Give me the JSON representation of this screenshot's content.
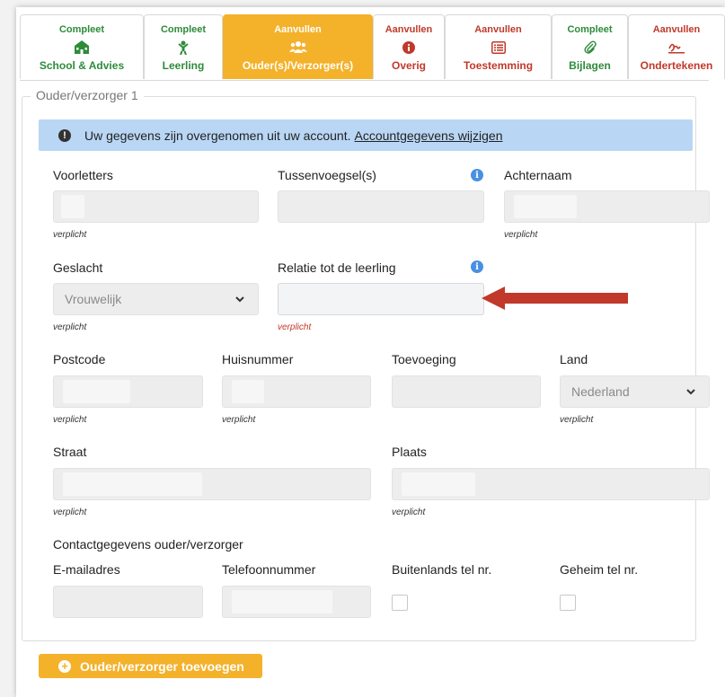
{
  "tabs": [
    {
      "status": "Compleet",
      "label": "School & Advies",
      "icon": "school-icon",
      "state": "done"
    },
    {
      "status": "Compleet",
      "label": "Leerling",
      "icon": "student-icon",
      "state": "done"
    },
    {
      "status": "Aanvullen",
      "label": "Ouder(s)/Verzorger(s)",
      "icon": "users-icon",
      "state": "active"
    },
    {
      "status": "Aanvullen",
      "label": "Overig",
      "icon": "info-icon",
      "state": "todo"
    },
    {
      "status": "Aanvullen",
      "label": "Toestemming",
      "icon": "list-icon",
      "state": "todo"
    },
    {
      "status": "Compleet",
      "label": "Bijlagen",
      "icon": "paperclip-icon",
      "state": "done"
    },
    {
      "status": "Aanvullen",
      "label": "Ondertekenen",
      "icon": "signature-icon",
      "state": "todo"
    }
  ],
  "section_legend": "Ouder/verzorger 1",
  "info_banner": {
    "text": "Uw gegevens zijn overgenomen uit uw account.",
    "link": "Accountgegevens wijzigen"
  },
  "fields": {
    "voorletters": {
      "label": "Voorletters",
      "note": "verplicht"
    },
    "tussenvoegsel": {
      "label": "Tussenvoegsel(s)"
    },
    "achternaam": {
      "label": "Achternaam",
      "note": "verplicht"
    },
    "geslacht": {
      "label": "Geslacht",
      "value": "Vrouwelijk",
      "note": "verplicht"
    },
    "relatie": {
      "label": "Relatie tot de leerling",
      "note": "verplicht"
    },
    "postcode": {
      "label": "Postcode",
      "note": "verplicht"
    },
    "huisnummer": {
      "label": "Huisnummer",
      "note": "verplicht"
    },
    "toevoeging": {
      "label": "Toevoeging"
    },
    "land": {
      "label": "Land",
      "value": "Nederland",
      "note": "verplicht"
    },
    "straat": {
      "label": "Straat",
      "note": "verplicht"
    },
    "plaats": {
      "label": "Plaats",
      "note": "verplicht"
    }
  },
  "contact": {
    "heading": "Contactgegevens ouder/verzorger",
    "email_label": "E-mailadres",
    "phone_label": "Telefoonnummer",
    "foreign_label": "Buitenlands tel nr.",
    "secret_label": "Geheim tel nr."
  },
  "add_button": "Ouder/verzorger toevoegen",
  "colors": {
    "accent": "#f4b12a",
    "done": "#2e8b3a",
    "todo": "#c0392b",
    "info_bg": "#b9d7f5",
    "arrow": "#c0392b"
  }
}
